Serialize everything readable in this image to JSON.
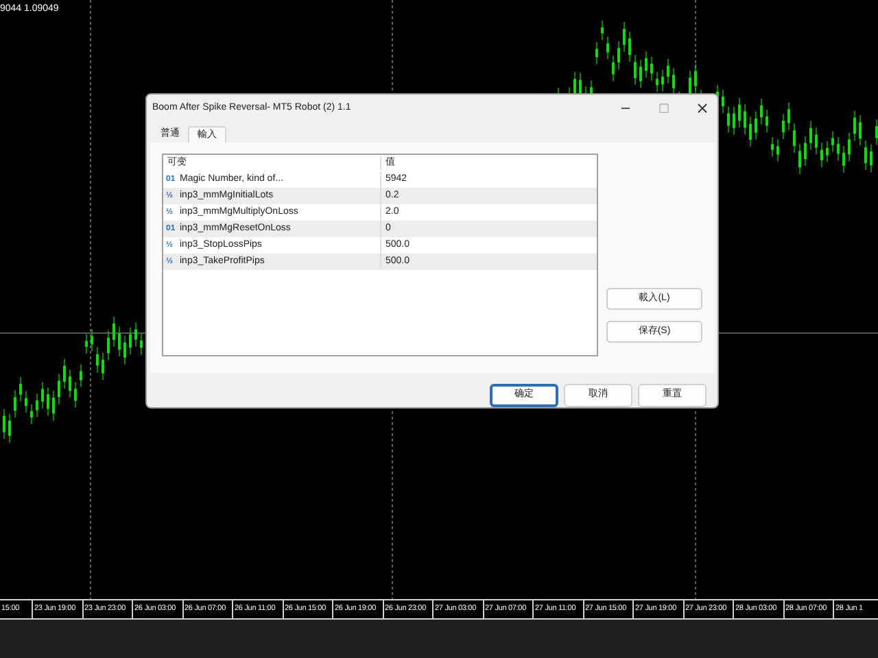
{
  "chart": {
    "price_label": "9044 1.09049",
    "time_axis": [
      "15:00",
      "23 Jun 19:00",
      "23 Jun 23:00",
      "26 Jun 03:00",
      "26 Jun 07:00",
      "26 Jun 11:00",
      "26 Jun 15:00",
      "26 Jun 19:00",
      "26 Jun 23:00",
      "27 Jun 03:00",
      "27 Jun 07:00",
      "27 Jun 11:00",
      "27 Jun 15:00",
      "27 Jun 19:00",
      "27 Jun 23:00",
      "28 Jun 03:00",
      "28 Jun 07:00",
      "28 Jun 1"
    ]
  },
  "dialog": {
    "title": "Boom After Spike Reversal- MT5 Robot (2) 1.1",
    "tabs": [
      {
        "label": "普通",
        "selected": false
      },
      {
        "label": "輸入",
        "selected": true
      }
    ],
    "table": {
      "columns": [
        "可变",
        "值"
      ],
      "rows": [
        {
          "type_icon": "01",
          "name": "Magic Number, kind of...",
          "value": "5942"
        },
        {
          "type_icon": "½",
          "name": "inp3_mmMgInitialLots",
          "value": "0.2"
        },
        {
          "type_icon": "½",
          "name": "inp3_mmMgMultiplyOnLoss",
          "value": "2.0"
        },
        {
          "type_icon": "01",
          "name": "inp3_mmMgResetOnLoss",
          "value": "0"
        },
        {
          "type_icon": "½",
          "name": "inp3_StopLossPips",
          "value": "500.0"
        },
        {
          "type_icon": "½",
          "name": "inp3_TakeProfitPips",
          "value": "500.0"
        }
      ]
    },
    "side_buttons": [
      "載入(L)",
      "保存(S)"
    ],
    "buttons": [
      {
        "label": "确定",
        "default": true
      },
      {
        "label": "取消",
        "default": false
      },
      {
        "label": "重置",
        "default": false
      }
    ]
  }
}
